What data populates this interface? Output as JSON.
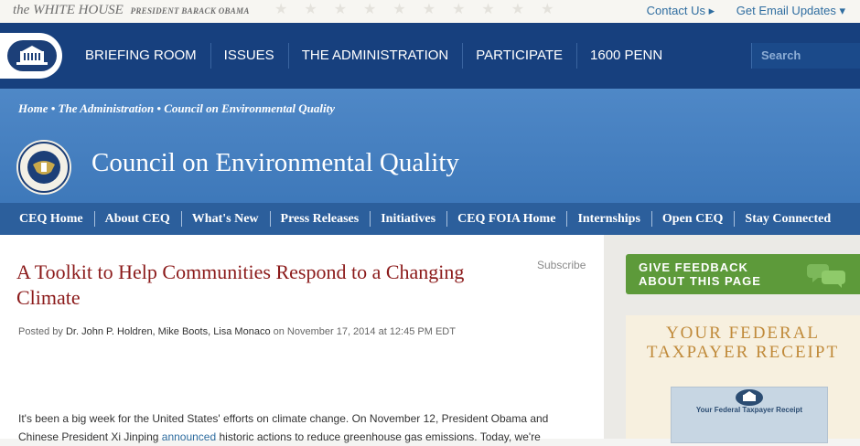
{
  "topbar": {
    "logo_text": "the WHITE HOUSE",
    "logo_sub": "PRESIDENT BARACK OBAMA",
    "contact_label": "Contact Us ▸",
    "updates_label": "Get Email Updates ▾"
  },
  "nav": {
    "items": [
      {
        "label": "BRIEFING ROOM"
      },
      {
        "label": "ISSUES"
      },
      {
        "label": "THE ADMINISTRATION"
      },
      {
        "label": "PARTICIPATE"
      },
      {
        "label": "1600 PENN"
      }
    ],
    "search_placeholder": "Search"
  },
  "header": {
    "breadcrumb": "Home • The Administration • Council on Environmental Quality",
    "title": "Council on Environmental Quality"
  },
  "subnav": {
    "items": [
      {
        "label": "CEQ Home"
      },
      {
        "label": "About CEQ"
      },
      {
        "label": "What's New"
      },
      {
        "label": "Press Releases"
      },
      {
        "label": "Initiatives"
      },
      {
        "label": "CEQ FOIA Home"
      },
      {
        "label": "Internships"
      },
      {
        "label": "Open CEQ"
      },
      {
        "label": "Stay Connected"
      }
    ]
  },
  "post": {
    "title": "A Toolkit to Help Communities Respond to a Changing Climate",
    "subscribe": "Subscribe",
    "posted_by": "Posted by",
    "authors": "Dr. John P. Holdren, Mike Boots, Lisa Monaco",
    "date": "on November 17, 2014 at 12:45 PM EDT",
    "p1_a": "It's been a big week for the United States' efforts on climate change. On November 12, President Obama and Chinese President Xi Jinping ",
    "p1_link": "announced",
    "p1_b": " historic actions to reduce greenhouse gas emissions. Today, we're"
  },
  "sidebar": {
    "feedback_line1": "GIVE FEEDBACK",
    "feedback_line2": "ABOUT THIS PAGE",
    "receipt_line1": "YOUR FEDERAL",
    "receipt_line2": "TAXPAYER RECEIPT",
    "receipt_thumb": "Your Federal Taxpayer Receipt"
  },
  "colors": {
    "nav_bg": "#17407e",
    "header_bg": "#4f88c7",
    "subnav_bg": "#2c5f9c",
    "title_red": "#8b1a1a",
    "feedback_green": "#5d9a3a",
    "receipt_gold": "#c08a3a"
  }
}
